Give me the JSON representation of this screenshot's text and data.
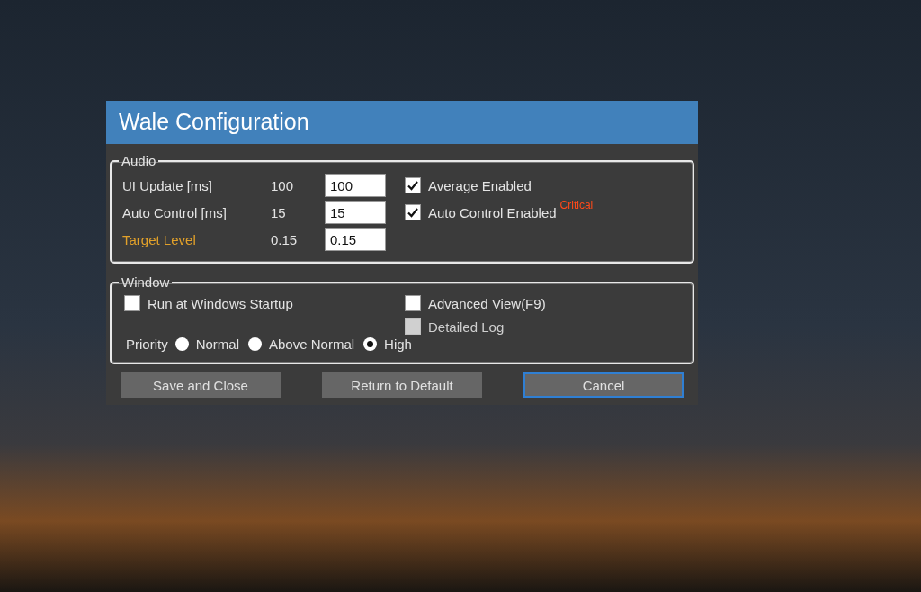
{
  "window": {
    "title": "Wale Configuration"
  },
  "audio": {
    "title": "Audio",
    "settings": [
      {
        "label": "UI Update [ms]",
        "highlight": false,
        "reading": "100",
        "value": "100"
      },
      {
        "label": "Auto Control [ms]",
        "highlight": false,
        "reading": "15",
        "value": "15"
      },
      {
        "label": "Target Level",
        "highlight": true,
        "reading": "0.15",
        "value": "0.15"
      }
    ],
    "options": [
      {
        "label": "Average Enabled",
        "checked": true
      },
      {
        "label": "Auto Control Enabled",
        "checked": true,
        "badge": "Critical"
      }
    ]
  },
  "window_group": {
    "title": "Window",
    "startup": {
      "label": "Run at Windows Startup",
      "checked": false
    },
    "options": [
      {
        "label": "Advanced View(F9)",
        "checked": false,
        "disabled": false
      },
      {
        "label": "Detailed Log",
        "checked": false,
        "disabled": true
      }
    ],
    "priority": {
      "label": "Priority",
      "choices": [
        {
          "label": "Normal",
          "selected": false
        },
        {
          "label": "Above Normal",
          "selected": false
        },
        {
          "label": "High",
          "selected": true
        }
      ]
    }
  },
  "buttons": [
    {
      "label": "Save and Close",
      "focused": false
    },
    {
      "label": "Return to Default",
      "focused": false
    },
    {
      "label": "Cancel",
      "focused": true
    }
  ]
}
